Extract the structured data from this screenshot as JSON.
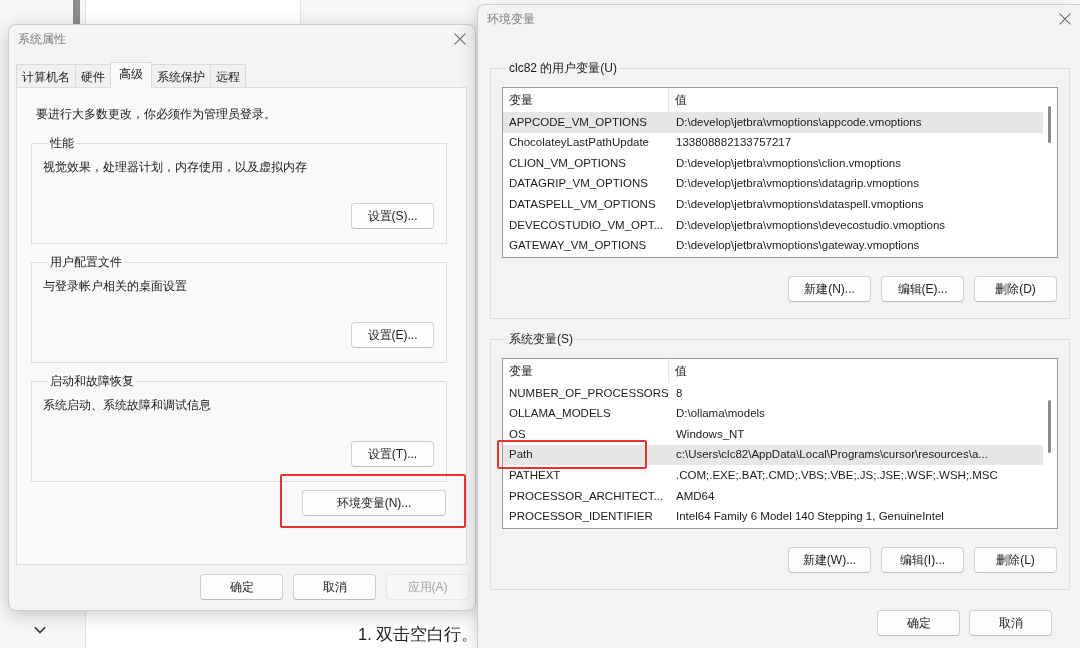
{
  "background": {
    "step_text": "1. 双击空白行。"
  },
  "system_properties": {
    "title": "系统属性",
    "tabs": [
      {
        "label": "计算机名",
        "selected": false
      },
      {
        "label": "硬件",
        "selected": false
      },
      {
        "label": "高级",
        "selected": true
      },
      {
        "label": "系统保护",
        "selected": false
      },
      {
        "label": "远程",
        "selected": false
      }
    ],
    "notice": "要进行大多数更改，你必须作为管理员登录。",
    "groups": [
      {
        "title": "性能",
        "description": "视觉效果，处理器计划，内存使用，以及虚拟内存",
        "button": "设置(S)..."
      },
      {
        "title": "用户配置文件",
        "description": "与登录帐户相关的桌面设置",
        "button": "设置(E)..."
      },
      {
        "title": "启动和故障恢复",
        "description": "系统启动、系统故障和调试信息",
        "button": "设置(T)..."
      }
    ],
    "env_button": {
      "label": "环境变量(N)...",
      "highlighted": true
    },
    "buttons": [
      {
        "label": "确定",
        "disabled": false
      },
      {
        "label": "取消",
        "disabled": false
      },
      {
        "label": "应用(A)",
        "disabled": true
      }
    ]
  },
  "environment_variables": {
    "title": "环境变量",
    "sections": [
      {
        "title": "clc82 的用户变量(U)",
        "columns": [
          "变量",
          "值"
        ],
        "rows": [
          {
            "name": "APPCODE_VM_OPTIONS",
            "value": "D:\\develop\\jetbra\\vmoptions\\appcode.vmoptions",
            "selected": true,
            "highlighted": false
          },
          {
            "name": "ChocolateyLastPathUpdate",
            "value": "133808882133757217",
            "selected": false,
            "highlighted": false
          },
          {
            "name": "CLION_VM_OPTIONS",
            "value": "D:\\develop\\jetbra\\vmoptions\\clion.vmoptions",
            "selected": false,
            "highlighted": false
          },
          {
            "name": "DATAGRIP_VM_OPTIONS",
            "value": "D:\\develop\\jetbra\\vmoptions\\datagrip.vmoptions",
            "selected": false,
            "highlighted": false
          },
          {
            "name": "DATASPELL_VM_OPTIONS",
            "value": "D:\\develop\\jetbra\\vmoptions\\dataspell.vmoptions",
            "selected": false,
            "highlighted": false
          },
          {
            "name": "DEVECOSTUDIO_VM_OPT...",
            "value": "D:\\develop\\jetbra\\vmoptions\\devecostudio.vmoptions",
            "selected": false,
            "highlighted": false
          },
          {
            "name": "GATEWAY_VM_OPTIONS",
            "value": "D:\\develop\\jetbra\\vmoptions\\gateway.vmoptions",
            "selected": false,
            "highlighted": false
          }
        ],
        "buttons": [
          "新建(N)...",
          "编辑(E)...",
          "删除(D)"
        ]
      },
      {
        "title": "系统变量(S)",
        "columns": [
          "变量",
          "值"
        ],
        "rows": [
          {
            "name": "NUMBER_OF_PROCESSORS",
            "value": "8",
            "selected": false,
            "highlighted": false
          },
          {
            "name": "OLLAMA_MODELS",
            "value": "D:\\ollama\\models",
            "selected": false,
            "highlighted": false
          },
          {
            "name": "OS",
            "value": "Windows_NT",
            "selected": false,
            "highlighted": false
          },
          {
            "name": "Path",
            "value": "c:\\Users\\clc82\\AppData\\Local\\Programs\\cursor\\resources\\a...",
            "selected": true,
            "highlighted": true
          },
          {
            "name": "PATHEXT",
            "value": ".COM;.EXE;.BAT;.CMD;.VBS;.VBE;.JS;.JSE;.WSF;.WSH;.MSC",
            "selected": false,
            "highlighted": false
          },
          {
            "name": "PROCESSOR_ARCHITECT...",
            "value": "AMD64",
            "selected": false,
            "highlighted": false
          },
          {
            "name": "PROCESSOR_IDENTIFIER",
            "value": "Intel64 Family 6 Model 140 Stepping 1, GenuineIntel",
            "selected": false,
            "highlighted": false
          }
        ],
        "buttons": [
          "新建(W)...",
          "编辑(I)...",
          "删除(L)"
        ]
      }
    ],
    "buttons": [
      "确定",
      "取消"
    ]
  }
}
